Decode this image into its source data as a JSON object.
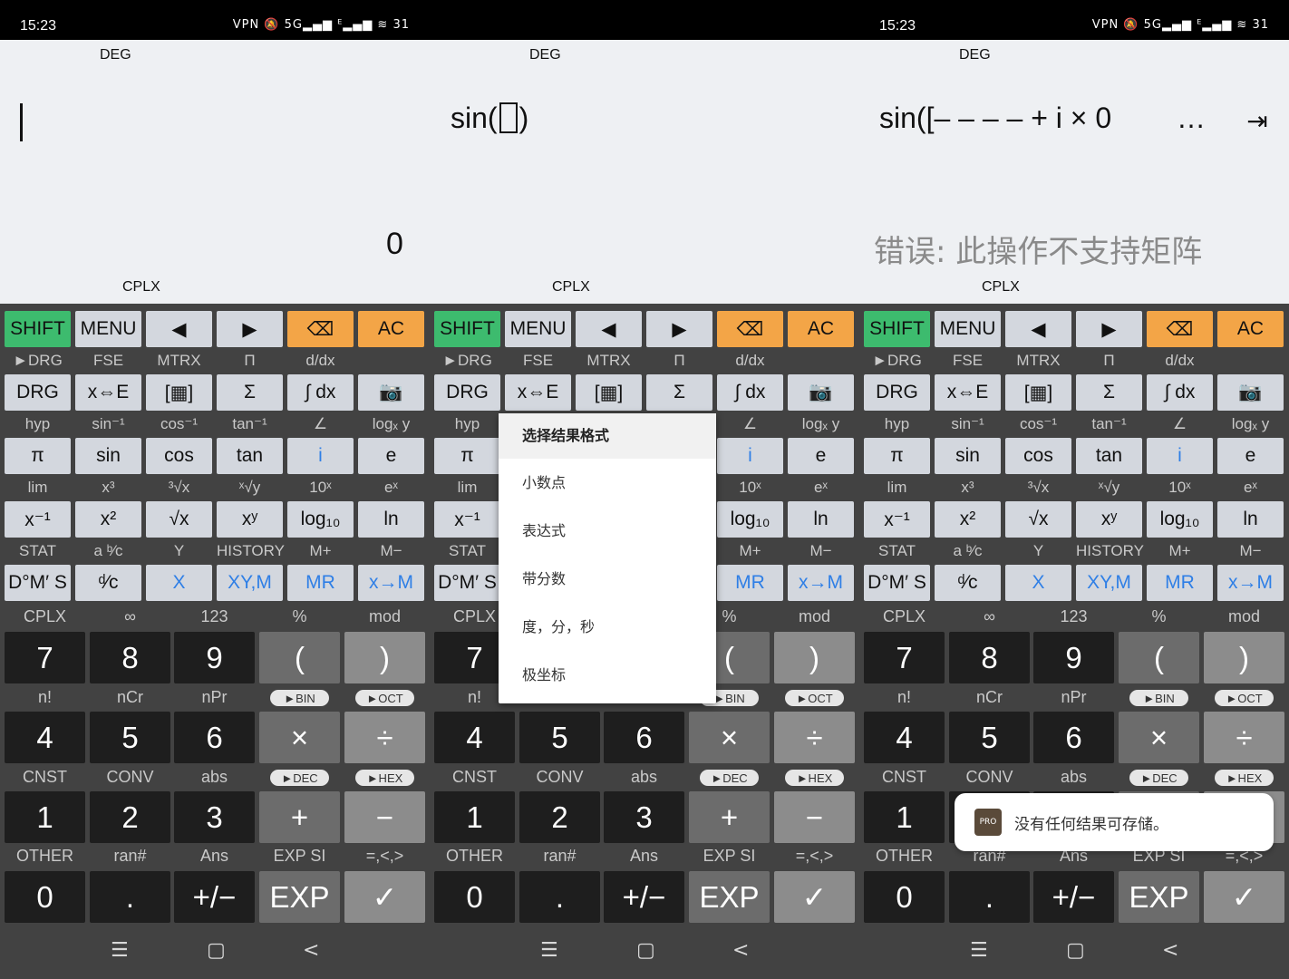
{
  "status": {
    "time": "15:23",
    "icons": "VPN 🔕 5G▂▄▆ ᴱ▂▄▆ ≋ 31"
  },
  "mode_deg": "DEG",
  "mode_cplx": "CPLX",
  "screen1": {
    "result": "0"
  },
  "screen2": {
    "expression_prefix": "sin(",
    "expression_suffix": ")",
    "menu": {
      "title": "选择结果格式",
      "items": [
        "小数点",
        "表达式",
        "带分数",
        "度，分，秒",
        "极坐标"
      ]
    }
  },
  "screen3": {
    "expression": "sin([– – – – + i × 0",
    "ellipsis": "…",
    "error": "错误: 此操作不支持矩阵",
    "toast": "没有任何结果可存储。"
  },
  "row1": [
    "SHIFT",
    "MENU",
    "◀",
    "▶",
    "⌫",
    "AC"
  ],
  "row1_labels": [
    "►DRG",
    "FSE",
    "MTRX",
    "Π",
    "d/dx",
    ""
  ],
  "row2": [
    "DRG",
    "x⇔E",
    "[▦]",
    "Σ",
    "∫ dx",
    "📷"
  ],
  "row2_labels": [
    "hyp",
    "sin⁻¹",
    "cos⁻¹",
    "tan⁻¹",
    "∠",
    "logₓ y"
  ],
  "row3": [
    "π",
    "sin",
    "cos",
    "tan",
    "i",
    "e"
  ],
  "row3_labels": [
    "lim",
    "x³",
    "³√x",
    "ˣ√y",
    "10ˣ",
    "eˣ"
  ],
  "row4": [
    "x⁻¹",
    "x²",
    "√x",
    "xʸ",
    "log₁₀",
    "ln"
  ],
  "row4_labels": [
    "STAT",
    "a ᵇ⁄c",
    "Y",
    "HISTORY",
    "M+",
    "M−"
  ],
  "row5": [
    "D°M′ S",
    "ᵈ⁄c",
    "X",
    "XY,M",
    "MR",
    "x→M"
  ],
  "num_labels1": [
    "CPLX",
    "∞",
    "123",
    "%",
    "mod"
  ],
  "num_row1": [
    "7",
    "8",
    "9",
    "(",
    ")"
  ],
  "num_labels2": [
    "n!",
    "nCr",
    "nPr",
    "►BIN",
    "►OCT"
  ],
  "num_row2": [
    "4",
    "5",
    "6",
    "×",
    "÷"
  ],
  "num_labels3": [
    "CNST",
    "CONV",
    "abs",
    "►DEC",
    "►HEX"
  ],
  "num_row3": [
    "1",
    "2",
    "3",
    "+",
    "−"
  ],
  "num_labels4": [
    "OTHER",
    "ran#",
    "Ans",
    "EXP SI",
    "=,<,>"
  ],
  "num_row4": [
    "0",
    ".",
    "+/−",
    "EXP",
    "✓"
  ],
  "nav": [
    "☰",
    "▢",
    "<"
  ]
}
